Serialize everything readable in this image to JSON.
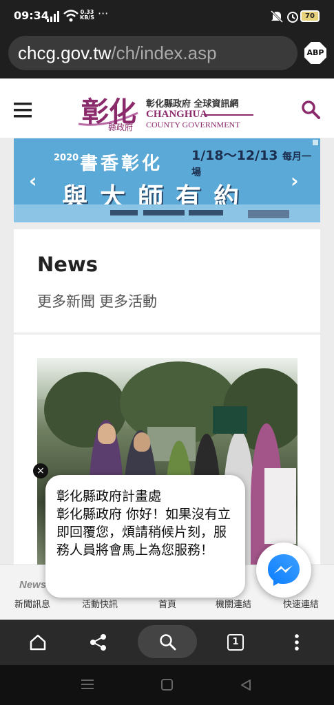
{
  "status_bar": {
    "time": "09:34",
    "net_speed_value": "0.33",
    "net_speed_unit": "KB/S",
    "more": "···",
    "battery": "70"
  },
  "browser": {
    "url_domain": "chcg.gov.tw",
    "url_path": "/ch/index.asp",
    "adblock_label": "ABP",
    "tab_count": "1"
  },
  "site_header": {
    "logo_char": "彰化",
    "logo_sub": "縣政府",
    "title_zh": "彰化縣政府 全球資訊網",
    "title_en_1": "CHANGHUA",
    "title_en_2": "COUNTY GOVERNMENT"
  },
  "banner": {
    "year": "2020",
    "line1": "書香彰化",
    "dates": "1/18～12/13",
    "dates_suffix": "每月一場",
    "line2": "與大師有約",
    "prev": "‹",
    "next": "›"
  },
  "news": {
    "title": "News",
    "more_news": "更多新聞",
    "more_events": "更多活動"
  },
  "bottom_nav": {
    "items": [
      "新聞訊息",
      "活動快訊",
      "首頁",
      "機關連結",
      "快速連結"
    ],
    "news_icon_text": "News"
  },
  "chat": {
    "sender": "彰化縣政府計畫處",
    "message": "彰化縣政府 你好！如果沒有立即回覆您，煩請稍候片刻，服務人員將會馬上為您服務！",
    "close": "×"
  },
  "colors": {
    "brand": "#8b2a6b",
    "banner_bg": "#5aa9d6",
    "messenger": "#0a7cff"
  }
}
